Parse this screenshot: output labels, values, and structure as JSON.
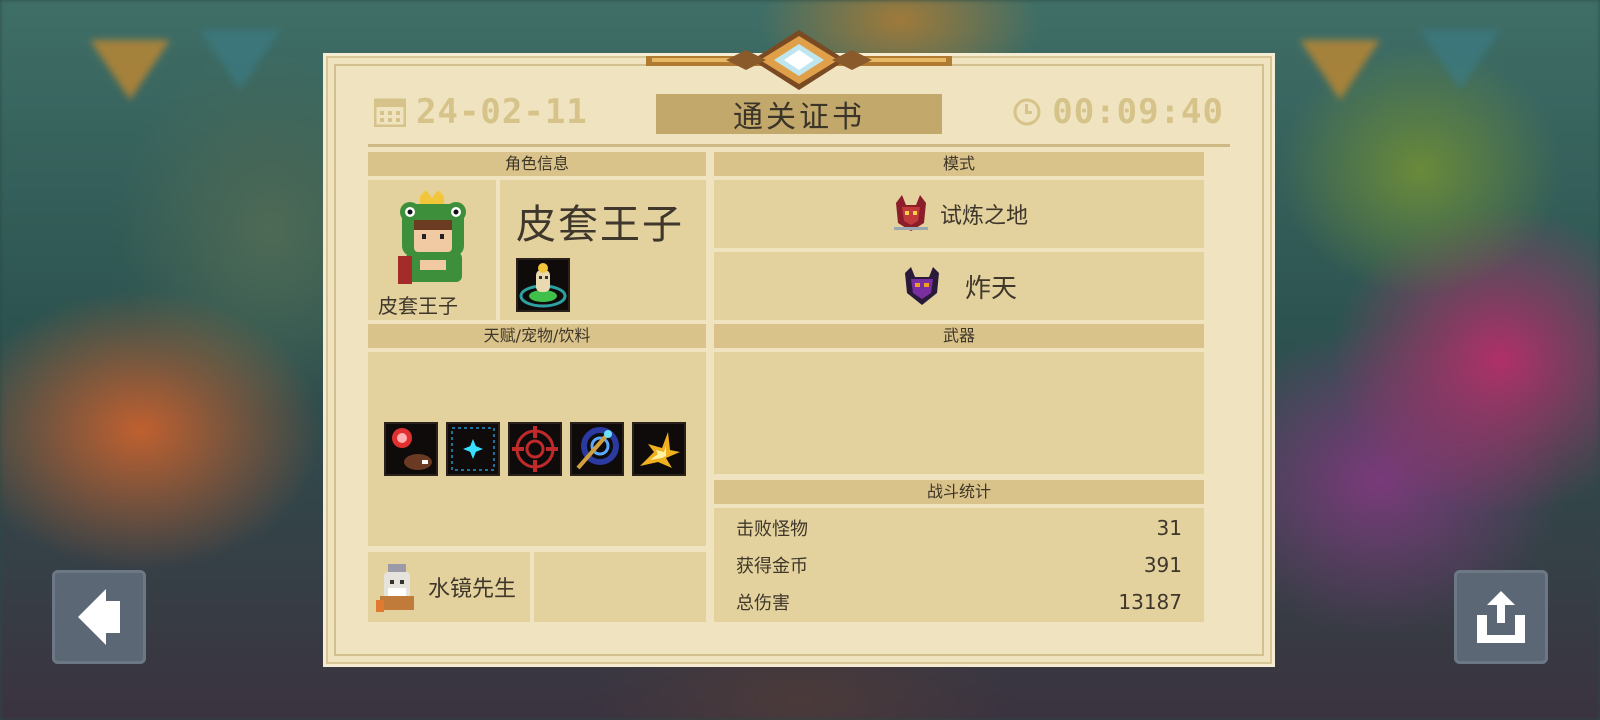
{
  "header": {
    "date": "24-02-11",
    "title": "通关证书",
    "time": "00:09:40",
    "calendar_icon": "calendar-icon",
    "clock_icon": "clock-icon"
  },
  "character": {
    "section_title": "角色信息",
    "name": "皮套王子",
    "portrait_label": "皮套王子",
    "portrait_icon": "frog-prince-portrait",
    "skill_icon": "character-skill-icon"
  },
  "mode": {
    "section_title": "模式",
    "items": [
      {
        "label": "试炼之地",
        "icon": "trial-grounds-icon"
      },
      {
        "label": "炸天",
        "icon": "demon-mode-icon"
      }
    ]
  },
  "buffs": {
    "section_title": "天赋/宠物/饮料",
    "icons": [
      "red-orb-buff-icon",
      "cyan-star-buff-icon",
      "crosshair-buff-icon",
      "vortex-sword-buff-icon",
      "explosion-buff-icon"
    ],
    "pet_name": "水镜先生",
    "pet_icon": "pet-sprite-icon"
  },
  "weapons": {
    "section_title": "武器"
  },
  "battle_stats": {
    "section_title": "战斗统计",
    "rows": [
      {
        "label": "击败怪物",
        "value": "31"
      },
      {
        "label": "获得金币",
        "value": "391"
      },
      {
        "label": "总伤害",
        "value": "13187"
      }
    ]
  },
  "buttons": {
    "back_icon": "back-arrow-icon",
    "share_icon": "share-icon"
  },
  "colors": {
    "parchment": "#f0e3c0",
    "panel": "#e3d29d",
    "panel_header": "#d9c38a",
    "ribbon": "#c2a86a",
    "header_text": "#d6c38a",
    "button": "#5b6774"
  }
}
